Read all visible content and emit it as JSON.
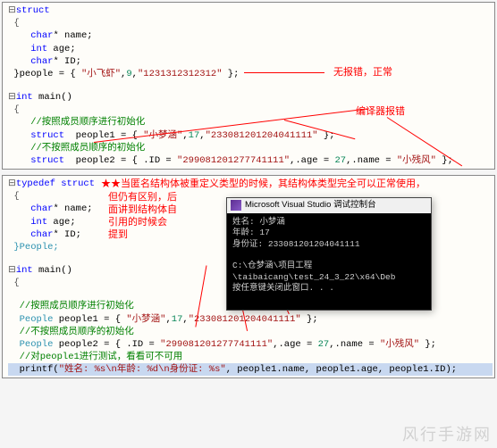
{
  "block1": {
    "l1_kw": "struct",
    "l2": "{",
    "l3_kw": "char",
    "l3_rest": "* name;",
    "l4_kw": "int",
    "l4_rest": " age;",
    "l5_kw": "char",
    "l5_rest": "* ID;",
    "l6_a": "}people = { ",
    "l6_s1": "\"小飞虾\"",
    "l6_b": ",",
    "l6_n1": "9",
    "l6_c": ",",
    "l6_s2": "\"1231312312312\"",
    "l6_d": " };",
    "anno_a": "无报错，正常",
    "l8_kw": "int",
    "l8_rest": " main()",
    "l9": "{",
    "l10": "    //按照成员顺序进行初始化",
    "anno_b": "编译器报错",
    "l11_kw": "    struct",
    "l11_ident": "  people1 = { ",
    "l11_s1": "\"小梦涵\"",
    "l11_b": ",",
    "l11_n1": "17",
    "l11_c": ",",
    "l11_s2": "\"233081201204041111\"",
    "l11_d": " };",
    "l12": "    //不按照成员顺序的初始化",
    "l13_kw": "    struct",
    "l13_ident": "  people2 = { .ID = ",
    "l13_s1": "\"299081201277741111\"",
    "l13_b": ",.age = ",
    "l13_n1": "27",
    "l13_c": ",.name = ",
    "l13_s2": "\"小残风\"",
    "l13_d": " };"
  },
  "block2": {
    "l1_kw": "typedef struct",
    "anno_star": "★当匿名结构体被重定义类型的时候，其结构体类型完全可以正常使用，",
    "anno_l2": "但仍有区别，后",
    "anno_l3": "面讲到结构体自",
    "anno_l4": "引用的时候会",
    "anno_l5": "提到",
    "l2": "{",
    "l3_kw": "char",
    "l3_rest": "* name;",
    "l4_kw": "int",
    "l4_rest": " age;",
    "l5_kw": "char",
    "l5_rest": "* ID;",
    "l6": "}People;",
    "l8_kw": "int",
    "l8_rest": " main()",
    "l9": "{",
    "l10": "  //按照成员顺序进行初始化",
    "l11_type": "  People",
    "l11_ident": " people1 = { ",
    "l11_s1": "\"小梦涵\"",
    "l11_b": ",",
    "l11_n1": "17",
    "l11_c": ",",
    "l11_s2": "\"233081201204041111\"",
    "l11_d": " };",
    "l12": "  //不按照成员顺序的初始化",
    "l13_type": "  People",
    "l13_ident": " people2 = { .ID = ",
    "l13_s1": "\"299081201277741111\"",
    "l13_b": ",.age = ",
    "l13_n1": "27",
    "l13_c": ",.name = ",
    "l13_s2": "\"小残风\"",
    "l13_d": " };",
    "l14": "  //对people1进行测试，看看可不可用",
    "l15_a": "  printf(",
    "l15_s1": "\"姓名: ",
    "l15_p1": "%s",
    "l15_n1": "\\n",
    "l15_s2": "年龄: ",
    "l15_p2": "%d",
    "l15_n2": "\\n",
    "l15_s3": "身份证: ",
    "l15_p3": "%s",
    "l15_s4": "\"",
    "l15_b": ", people1.name, people1.age, people1.ID);"
  },
  "console": {
    "title": "Microsoft Visual Studio 调试控制台",
    "body": "姓名: 小梦涵\n年龄: 17\n身份证: 233081201204041111\n\nC:\\仓梦涵\\项目工程\\taibaicang\\test_24_3_22\\x64\\Deb\n按任意键关闭此窗口. . ."
  },
  "watermark": "风行手游网"
}
